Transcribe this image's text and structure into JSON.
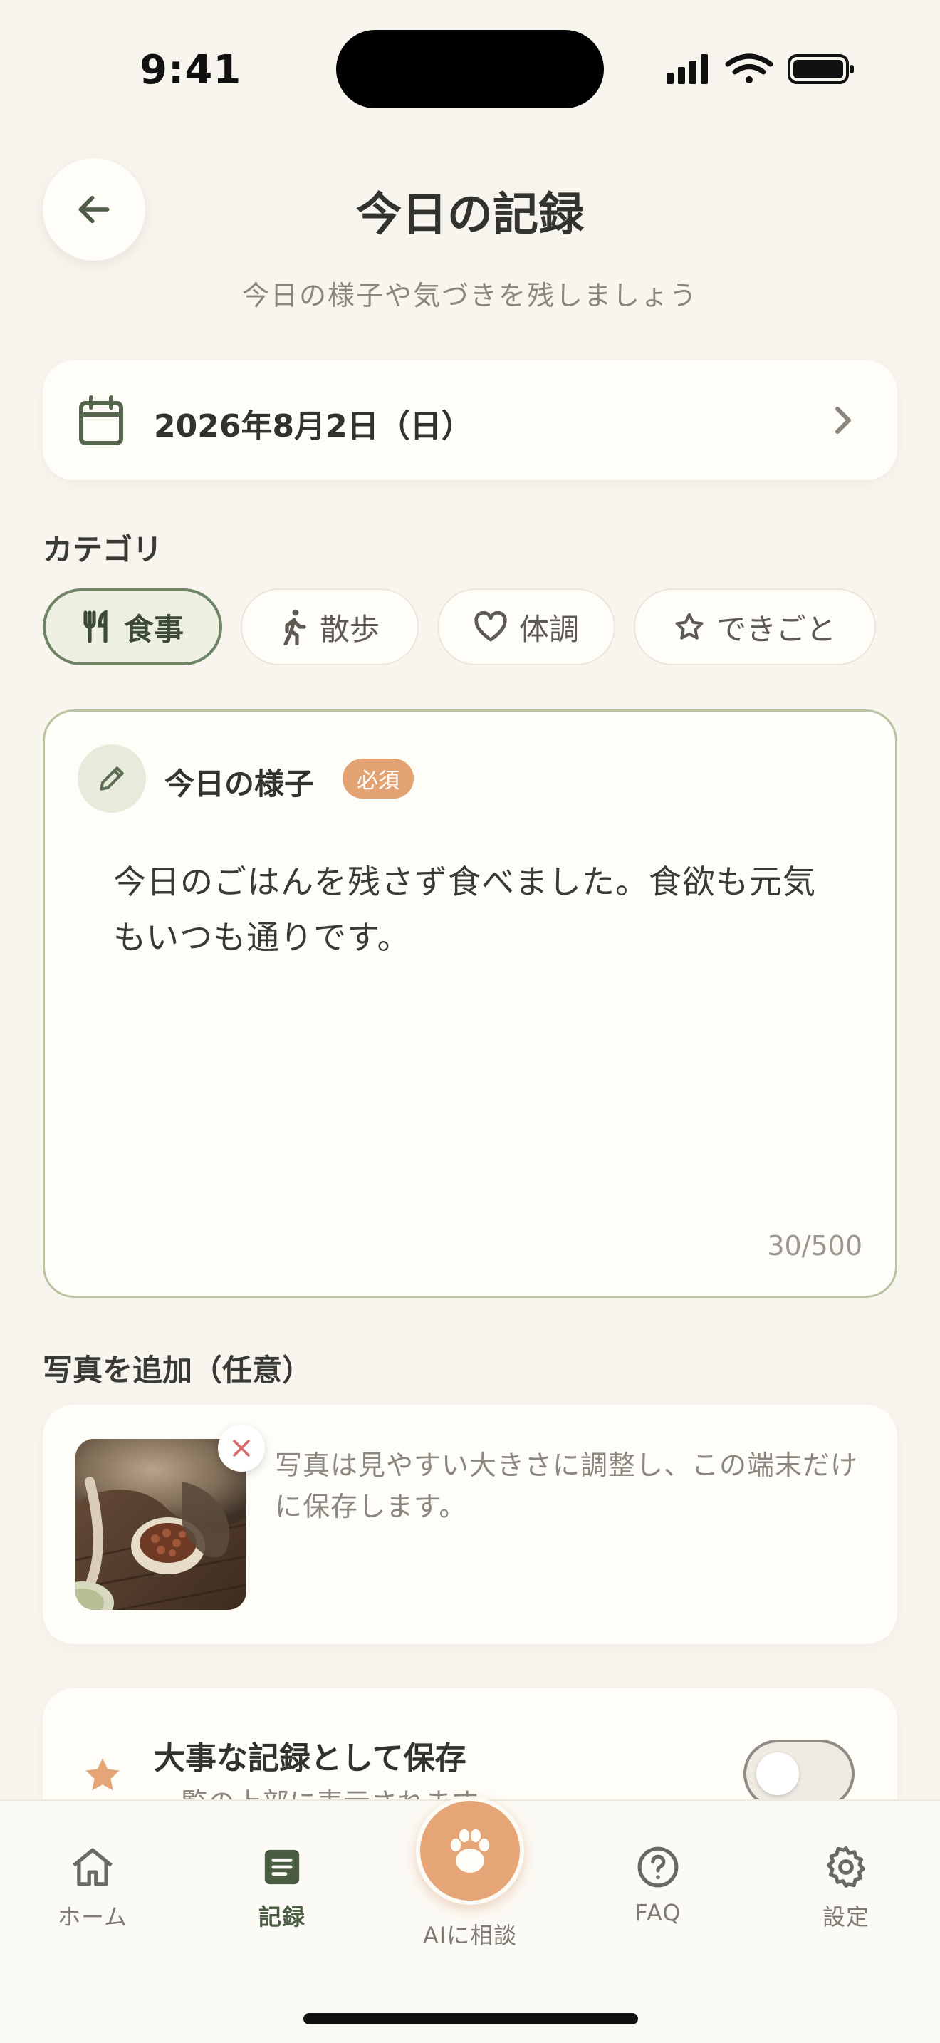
{
  "status_bar": {
    "time": "9:41"
  },
  "header": {
    "title": "今日の記録",
    "subtitle": "今日の様子や気づきを残しましょう"
  },
  "date": {
    "label": "2026年8月2日（日）"
  },
  "category": {
    "label": "カテゴリ",
    "chips": [
      {
        "label": "食事",
        "icon": "fork-knife-icon",
        "selected": true
      },
      {
        "label": "散歩",
        "icon": "walk-icon",
        "selected": false
      },
      {
        "label": "体調",
        "icon": "heart-icon",
        "selected": false
      },
      {
        "label": "できごと",
        "icon": "star-outline-icon",
        "selected": false
      }
    ]
  },
  "note": {
    "title": "今日の様子",
    "required_badge": "必須",
    "body": "今日のごはんを残さず食べました。食欲も元気もいつも通りです。",
    "char_count": "30/500"
  },
  "photo": {
    "section_label": "写真を追加（任意）",
    "description": "写真は見やすい大きさに調整し、この端末だけに保存します。"
  },
  "favorite": {
    "title": "大事な記録として保存",
    "subtitle": "一覧の上部に表示されます",
    "enabled": false
  },
  "tab_bar": {
    "items": [
      {
        "label": "ホーム",
        "icon": "home-icon"
      },
      {
        "label": "記録",
        "icon": "document-icon",
        "active": true
      },
      {
        "label": "AIに相談",
        "icon": "paw-icon"
      },
      {
        "label": "FAQ",
        "icon": "question-icon"
      },
      {
        "label": "設定",
        "icon": "gear-icon"
      }
    ]
  },
  "colors": {
    "background": "#f8f5ef",
    "primary_green": "#6f8465",
    "accent_orange": "#e6a576"
  }
}
